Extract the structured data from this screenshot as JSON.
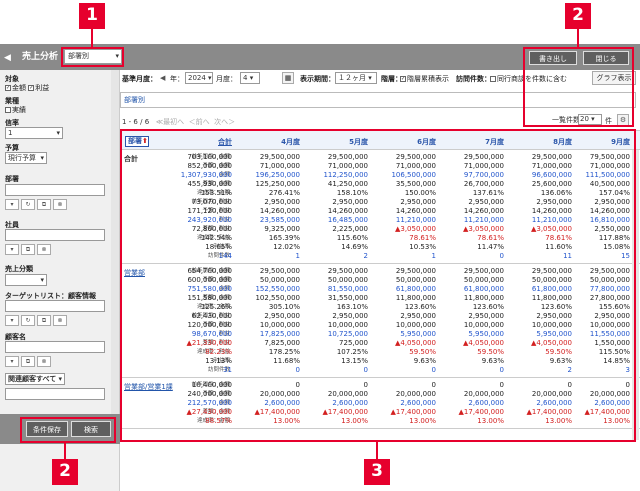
{
  "app": {
    "title": "売上分析",
    "collapse_icon": "◀"
  },
  "header": {
    "dept_select": "部署別",
    "export_label": "書き出し",
    "close_label": "閉じる"
  },
  "sidebar": {
    "target_label": "対象",
    "target_amount": "金額",
    "target_profit": "利益",
    "industry_label": "業種",
    "industry_actual": "実績",
    "rate_label": "信率",
    "rate_value": "1",
    "budget_label": "予算",
    "budget_value": "現行予算",
    "dept_label": "部署",
    "staff_label": "社員",
    "sales_class_label": "売上分類",
    "target_list_label": "ターゲットリスト：顧客情報",
    "customer_label": "顧客名",
    "related_customer_value": "関連顧客すべて",
    "save_cond_label": "条件保存",
    "search_label": "検索"
  },
  "filters": {
    "base_month_label": "基準月度：",
    "prev": "◀",
    "year_prefix": "年：",
    "year": "2024",
    "month_label": "月度：",
    "month": "4",
    "period_label": "表示期間：",
    "period": "１２ヶ月",
    "ratio_label": "階層：",
    "ratio_opt": "階層累積表示",
    "visit_label": "訪問件数：",
    "visit_opt": "同行商談を件数に含む",
    "graph_label": "グラフ表示"
  },
  "dept_bar": "部署別",
  "pager": {
    "range": "1 - 6 / 6",
    "first": "≪最初へ",
    "prev": "＜前へ",
    "next": "次へ＞",
    "perpage_label": "一覧件数",
    "perpage": "20",
    "perpage_unit": "件"
  },
  "table": {
    "sort_label": "部署",
    "sort_icon": "⬆",
    "columns": [
      "合計",
      "4月度",
      "5月度",
      "6月度",
      "7月度",
      "8月度",
      "9月度"
    ],
    "groups": [
      {
        "name": "合計",
        "link": false,
        "rows": [
          {
            "label": "前年同月：金額",
            "vals": [
              "703,100,000",
              "29,500,000",
              "29,500,000",
              "29,500,000",
              "29,500,000",
              "29,500,000",
              "79,500,000"
            ]
          },
          {
            "label": "予算：金額",
            "vals": [
              "852,000,000",
              "71,000,000",
              "71,000,000",
              "71,000,000",
              "71,000,000",
              "71,000,000",
              "71,000,000"
            ]
          },
          {
            "label": "金額",
            "vals": [
              "1,307,930,000",
              "196,250,000",
              "112,250,000",
              "106,500,000",
              "97,700,000",
              "96,600,000",
              "111,500,000"
            ],
            "cls": "blue"
          },
          {
            "label": "差額：金額",
            "vals": [
              "455,930,000",
              "125,250,000",
              "41,250,000",
              "35,500,000",
              "26,700,000",
              "25,600,000",
              "40,500,000"
            ]
          },
          {
            "label": "達成率：金額",
            "vals": [
              "153.51%",
              "276.41%",
              "158.10%",
              "150.00%",
              "137.61%",
              "136.06%",
              "157.04%"
            ]
          },
          {
            "label": "前年同月：利益",
            "vals": [
              "73,070,000",
              "2,950,000",
              "2,950,000",
              "2,950,000",
              "2,950,000",
              "2,950,000",
              "2,950,000"
            ]
          },
          {
            "label": "予算：利益",
            "vals": [
              "171,120,000",
              "14,260,000",
              "14,260,000",
              "14,260,000",
              "14,260,000",
              "14,260,000",
              "14,260,000"
            ]
          },
          {
            "label": "利益",
            "vals": [
              "243,920,000",
              "23,585,000",
              "16,485,000",
              "11,210,000",
              "11,210,000",
              "11,210,000",
              "16,810,000"
            ],
            "cls": "blue"
          },
          {
            "label": "差額：利益",
            "vals": [
              "72,800,000",
              "9,325,000",
              "2,225,000",
              "▲3,050,000",
              "▲3,050,000",
              "▲3,050,000",
              "2,550,000"
            ],
            "neg": [
              3,
              4,
              5
            ]
          },
          {
            "label": "達成率：利益",
            "vals": [
              "142.54%",
              "165.39%",
              "115.60%",
              "78.61%",
              "78.61%",
              "78.61%",
              "117.88%"
            ],
            "neg": [
              3,
              4,
              5
            ]
          },
          {
            "label": "利益率",
            "vals": [
              "18.65%",
              "12.02%",
              "14.69%",
              "10.53%",
              "11.47%",
              "11.60%",
              "15.08%"
            ]
          },
          {
            "label": "訪問件数",
            "vals": [
              "144",
              "1",
              "2",
              "1",
              "0",
              "11",
              "15"
            ],
            "cls": "blue"
          }
        ]
      },
      {
        "name": "営業部",
        "link": true,
        "rows": [
          {
            "label": "前年同月：金額",
            "vals": [
              "654,700,000",
              "29,500,000",
              "29,500,000",
              "29,500,000",
              "29,500,000",
              "29,500,000",
              "29,500,000"
            ]
          },
          {
            "label": "予算：金額",
            "vals": [
              "600,000,000",
              "50,000,000",
              "50,000,000",
              "50,000,000",
              "50,000,000",
              "50,000,000",
              "50,000,000"
            ]
          },
          {
            "label": "金額",
            "vals": [
              "751,580,000",
              "152,550,000",
              "81,550,000",
              "61,800,000",
              "61,800,000",
              "61,800,000",
              "77,800,000"
            ],
            "cls": "blue"
          },
          {
            "label": "差額：金額",
            "vals": [
              "151,580,000",
              "102,550,000",
              "31,550,000",
              "11,800,000",
              "11,800,000",
              "11,800,000",
              "27,800,000"
            ]
          },
          {
            "label": "達成率：金額",
            "vals": [
              "125.26%",
              "305.10%",
              "163.10%",
              "123.60%",
              "123.60%",
              "123.60%",
              "155.60%"
            ]
          },
          {
            "label": "前年同月：利益",
            "vals": [
              "62,430,000",
              "2,950,000",
              "2,950,000",
              "2,950,000",
              "2,950,000",
              "2,950,000",
              "2,950,000"
            ]
          },
          {
            "label": "予算：利益",
            "vals": [
              "120,000,000",
              "10,000,000",
              "10,000,000",
              "10,000,000",
              "10,000,000",
              "10,000,000",
              "10,000,000"
            ]
          },
          {
            "label": "利益",
            "vals": [
              "98,670,000",
              "17,825,000",
              "10,725,000",
              "5,950,000",
              "5,950,000",
              "5,950,000",
              "11,550,000"
            ],
            "cls": "blue"
          },
          {
            "label": "差額：利益",
            "vals": [
              "▲21,330,000",
              "7,825,000",
              "725,000",
              "▲4,050,000",
              "▲4,050,000",
              "▲4,050,000",
              "1,550,000"
            ],
            "neg": [
              0,
              3,
              4,
              5
            ]
          },
          {
            "label": "達成率：利益",
            "vals": [
              "82.23%",
              "178.25%",
              "107.25%",
              "59.50%",
              "59.50%",
              "59.50%",
              "115.50%"
            ],
            "neg": [
              0,
              3,
              4,
              5
            ]
          },
          {
            "label": "利益率",
            "vals": [
              "13.13%",
              "11.68%",
              "13.15%",
              "9.63%",
              "9.63%",
              "9.63%",
              "14.85%"
            ]
          },
          {
            "label": "訪問件数",
            "vals": [
              "31",
              "0",
              "0",
              "0",
              "0",
              "2",
              "3"
            ],
            "cls": "blue"
          }
        ]
      },
      {
        "name": "営業部/営業1課",
        "link": true,
        "rows": [
          {
            "label": "前年同月：金額",
            "vals": [
              "10,400,000",
              "0",
              "0",
              "0",
              "0",
              "0",
              "0"
            ]
          },
          {
            "label": "予算：金額",
            "vals": [
              "240,000,000",
              "20,000,000",
              "20,000,000",
              "20,000,000",
              "20,000,000",
              "20,000,000",
              "20,000,000"
            ]
          },
          {
            "label": "金額",
            "vals": [
              "212,570,000",
              "2,600,000",
              "2,600,000",
              "2,600,000",
              "2,600,000",
              "2,600,000",
              "2,600,000"
            ],
            "cls": "blue"
          },
          {
            "label": "差額：金額",
            "vals": [
              "▲27,430,000",
              "▲17,400,000",
              "▲17,400,000",
              "▲17,400,000",
              "▲17,400,000",
              "▲17,400,000",
              "▲17,400,000"
            ],
            "cls": "red"
          },
          {
            "label": "達成率：金額",
            "vals": [
              "88.57%",
              "13.00%",
              "13.00%",
              "13.00%",
              "13.00%",
              "13.00%",
              "13.00%"
            ],
            "cls": "red"
          }
        ]
      }
    ]
  },
  "callouts": {
    "c1": "1",
    "c2": "2",
    "c3": "3"
  }
}
